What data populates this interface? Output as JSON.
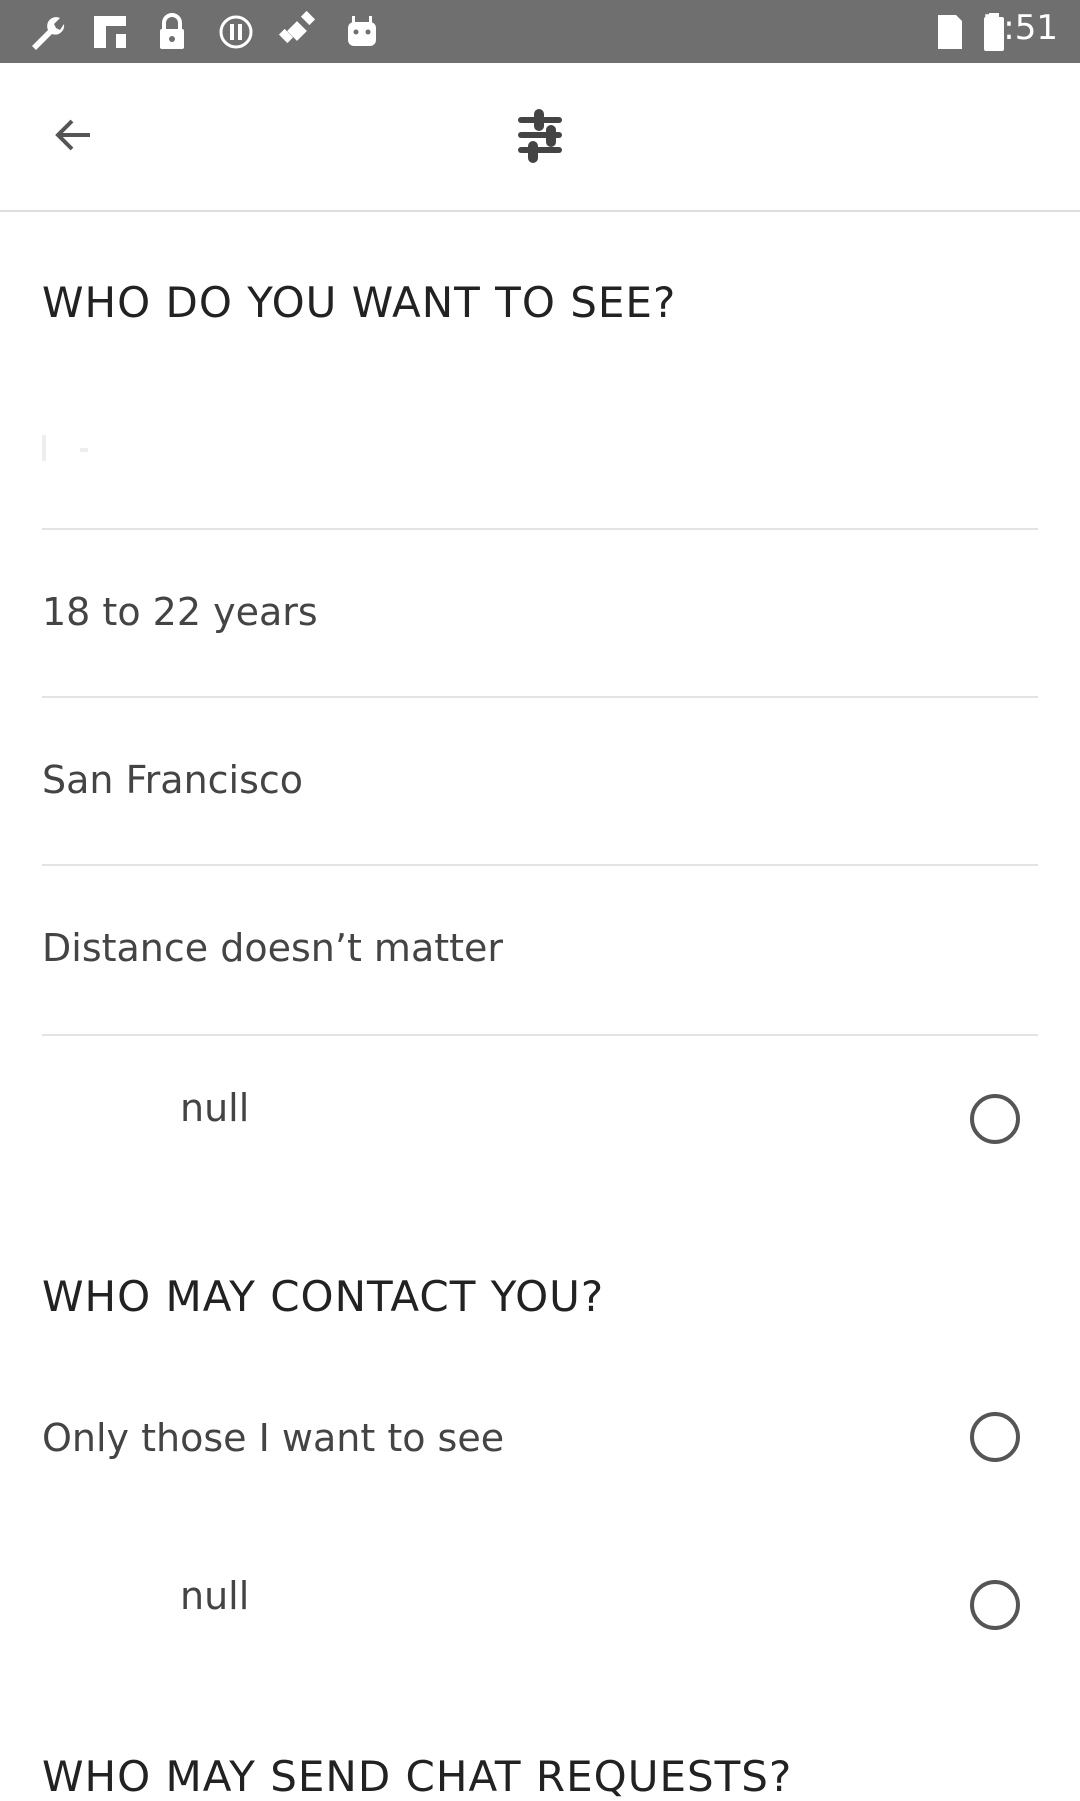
{
  "status_bar": {
    "time": "5:51",
    "icons_left": [
      "wrench-icon",
      "flipboard-icon",
      "lock-icon",
      "pause-icon",
      "satellite-fake-icon",
      "android-icon"
    ],
    "icons_right": [
      "sim-card-icon",
      "signal-icon",
      "battery-icon"
    ]
  },
  "app_bar": {
    "back_icon": "arrow-back-icon",
    "filter_icon": "sliders-icon"
  },
  "see_section": {
    "title": "WHO DO YOU WANT TO SEE?",
    "items": [
      {
        "label": ""
      },
      {
        "label": "18 to 22 years"
      },
      {
        "label": "San Francisco"
      },
      {
        "label": "Distance doesn’t matter"
      },
      {
        "label": "null",
        "selected": false
      }
    ]
  },
  "contact_section": {
    "title": "WHO MAY CONTACT YOU?",
    "options": [
      {
        "label": "Only those I want to see",
        "selected": false
      },
      {
        "label": "null",
        "selected": false
      }
    ]
  },
  "chat_section": {
    "title": "WHO MAY SEND CHAT REQUESTS?"
  },
  "colors": {
    "status_bar": "#6f6f6f",
    "text": "#444444",
    "title": "#222222",
    "divider": "#e4e4e4"
  }
}
